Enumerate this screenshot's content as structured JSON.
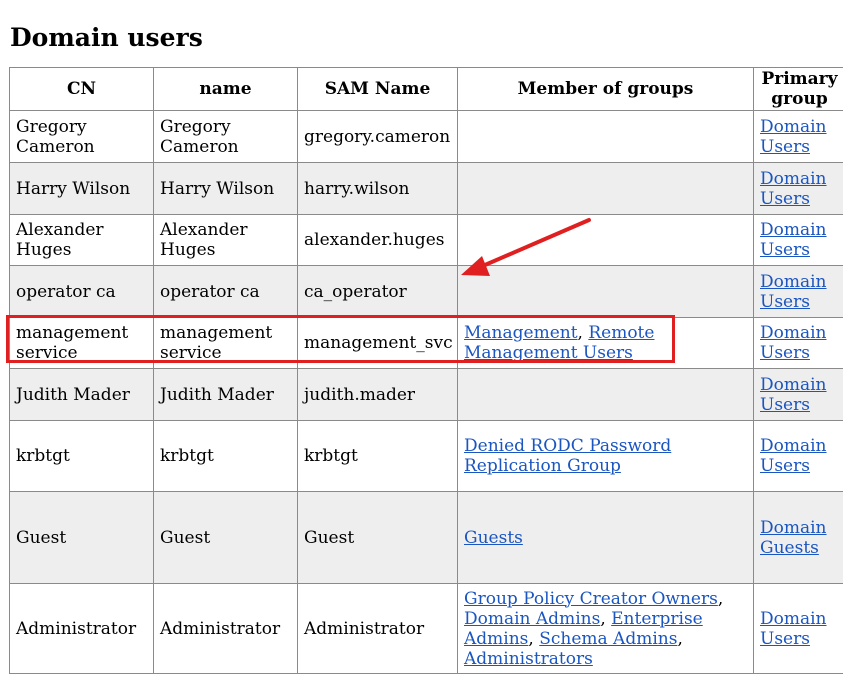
{
  "page": {
    "title": "Domain users"
  },
  "table": {
    "headers": [
      "CN",
      "name",
      "SAM Name",
      "Member of groups",
      "Primary group"
    ],
    "rows": [
      {
        "cn": "Gregory Cameron",
        "name": "Gregory Cameron",
        "sam": "gregory.cameron",
        "groups": [],
        "primary": "Domain Users"
      },
      {
        "cn": "Harry Wilson",
        "name": "Harry Wilson",
        "sam": "harry.wilson",
        "groups": [],
        "primary": "Domain Users"
      },
      {
        "cn": "Alexander Huges",
        "name": "Alexander Huges",
        "sam": "alexander.huges",
        "groups": [],
        "primary": "Domain Users"
      },
      {
        "cn": "operator ca",
        "name": "operator ca",
        "sam": "ca_operator",
        "groups": [],
        "primary": "Domain Users"
      },
      {
        "cn": "management service",
        "name": "management service",
        "sam": "management_svc",
        "groups": [
          "Management",
          "Remote Management Users"
        ],
        "primary": "Domain Users"
      },
      {
        "cn": "Judith Mader",
        "name": "Judith Mader",
        "sam": "judith.mader",
        "groups": [],
        "primary": "Domain Users"
      },
      {
        "cn": "krbtgt",
        "name": "krbtgt",
        "sam": "krbtgt",
        "groups": [
          "Denied RODC Password Replication Group"
        ],
        "primary": "Domain Users"
      },
      {
        "cn": "Guest",
        "name": "Guest",
        "sam": "Guest",
        "groups": [
          "Guests"
        ],
        "primary": "Domain Guests"
      },
      {
        "cn": "Administrator",
        "name": "Administrator",
        "sam": "Administrator",
        "groups": [
          "Group Policy Creator Owners",
          "Domain Admins",
          "Enterprise Admins",
          "Schema Admins",
          "Administrators"
        ],
        "primary": "Domain Users"
      }
    ]
  },
  "colors": {
    "link": "#1a55c0",
    "annotation": "#e02020",
    "alt_row": "#eeeeee"
  }
}
